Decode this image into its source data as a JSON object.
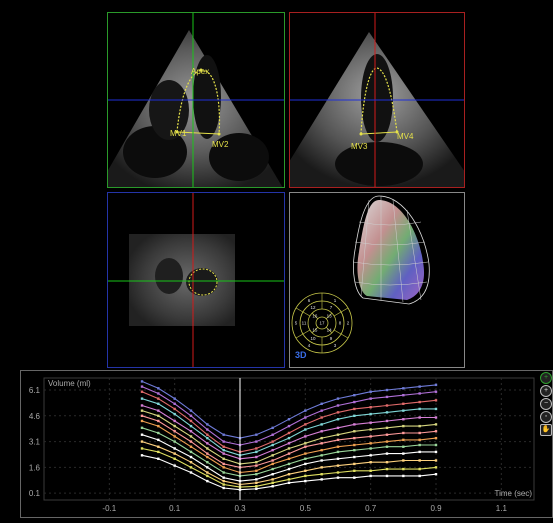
{
  "apical_4ch": {
    "labels": {
      "apex": "Apex",
      "mv1": "MV1",
      "mv2": "MV2"
    }
  },
  "apical_2ch": {
    "labels": {
      "mv3": "MV3",
      "mv4": "MV4"
    }
  },
  "render_3d": {
    "label": "3D",
    "bullseye_segments": [
      "1",
      "2",
      "3",
      "4",
      "5",
      "6",
      "7",
      "8",
      "9",
      "10",
      "11",
      "12",
      "13",
      "14",
      "15",
      "16",
      "17"
    ]
  },
  "toolbar": {
    "icons": [
      "plus-icon",
      "zoom-in-icon",
      "zoom-out-icon",
      "zoom-fit-icon",
      "hand-icon"
    ]
  },
  "colors": {
    "crosshair_green": "#19c419",
    "crosshair_red": "#d21a1a",
    "crosshair_blue": "#1f2fd6",
    "frame_green": "#2a9a2a",
    "frame_red": "#a82020",
    "frame_blue": "#2434a8",
    "frame_gray": "#888888",
    "trace": "#e6e24a",
    "cursor": "#ffffff"
  },
  "chart_data": {
    "type": "line",
    "ylabel": "Volume (ml)",
    "xlabel": "Time (sec)",
    "yticks": [
      "6.1",
      "4.6",
      "3.1",
      "1.6",
      "0.1"
    ],
    "ytick_values": [
      6.1,
      4.6,
      3.1,
      1.6,
      0.1
    ],
    "xticks": [
      "-0.1",
      "0.1",
      "0.3",
      "0.5",
      "0.7",
      "0.9",
      "1.1"
    ],
    "xtick_values": [
      -0.1,
      0.1,
      0.3,
      0.5,
      0.7,
      0.9,
      1.1
    ],
    "xlim": [
      -0.3,
      1.2
    ],
    "ylim": [
      -0.3,
      6.8
    ],
    "cursor_x": 0.3,
    "x": [
      0.0,
      0.05,
      0.1,
      0.15,
      0.2,
      0.25,
      0.3,
      0.35,
      0.4,
      0.45,
      0.5,
      0.55,
      0.6,
      0.65,
      0.7,
      0.75,
      0.8,
      0.85,
      0.9
    ],
    "series": [
      {
        "color": "#6f7bd8",
        "values": [
          6.6,
          6.2,
          5.6,
          4.9,
          4.1,
          3.5,
          3.3,
          3.5,
          3.9,
          4.4,
          4.9,
          5.3,
          5.6,
          5.8,
          6.0,
          6.1,
          6.2,
          6.3,
          6.4
        ]
      },
      {
        "color": "#b070d8",
        "values": [
          6.3,
          5.9,
          5.3,
          4.6,
          3.8,
          3.1,
          2.9,
          3.1,
          3.5,
          4.0,
          4.5,
          4.9,
          5.2,
          5.4,
          5.6,
          5.7,
          5.8,
          5.9,
          6.0
        ]
      },
      {
        "color": "#e06a6a",
        "values": [
          6.0,
          5.6,
          5.0,
          4.3,
          3.5,
          2.8,
          2.5,
          2.7,
          3.1,
          3.6,
          4.1,
          4.5,
          4.8,
          5.0,
          5.1,
          5.2,
          5.3,
          5.4,
          5.5
        ]
      },
      {
        "color": "#7fd6d6",
        "values": [
          5.6,
          5.3,
          4.7,
          4.0,
          3.3,
          2.6,
          2.3,
          2.5,
          2.9,
          3.3,
          3.8,
          4.1,
          4.4,
          4.6,
          4.7,
          4.8,
          4.9,
          5.0,
          5.0
        ]
      },
      {
        "color": "#d67fd6",
        "values": [
          5.2,
          4.9,
          4.3,
          3.7,
          3.0,
          2.4,
          2.1,
          2.2,
          2.6,
          3.0,
          3.4,
          3.7,
          3.9,
          4.1,
          4.2,
          4.3,
          4.4,
          4.5,
          4.5
        ]
      },
      {
        "color": "#d6d67f",
        "values": [
          4.9,
          4.6,
          4.0,
          3.4,
          2.7,
          2.1,
          1.8,
          1.9,
          2.3,
          2.7,
          3.0,
          3.3,
          3.5,
          3.7,
          3.8,
          3.9,
          4.0,
          4.0,
          4.1
        ]
      },
      {
        "color": "#ff9a9a",
        "values": [
          4.6,
          4.3,
          3.7,
          3.1,
          2.4,
          1.8,
          1.6,
          1.7,
          2.0,
          2.4,
          2.8,
          3.0,
          3.2,
          3.3,
          3.4,
          3.5,
          3.6,
          3.6,
          3.7
        ]
      },
      {
        "color": "#f0a050",
        "values": [
          4.3,
          4.0,
          3.4,
          2.8,
          2.2,
          1.6,
          1.3,
          1.4,
          1.8,
          2.1,
          2.4,
          2.6,
          2.8,
          2.9,
          3.0,
          3.1,
          3.2,
          3.2,
          3.3
        ]
      },
      {
        "color": "#9ad69a",
        "values": [
          3.9,
          3.6,
          3.1,
          2.5,
          1.9,
          1.3,
          1.1,
          1.2,
          1.5,
          1.8,
          2.1,
          2.3,
          2.5,
          2.6,
          2.7,
          2.8,
          2.8,
          2.9,
          2.9
        ]
      },
      {
        "color": "#ffffff",
        "values": [
          3.5,
          3.2,
          2.7,
          2.2,
          1.6,
          1.0,
          0.8,
          0.9,
          1.2,
          1.5,
          1.8,
          2.0,
          2.1,
          2.2,
          2.3,
          2.4,
          2.4,
          2.5,
          2.5
        ]
      },
      {
        "color": "#ffd27f",
        "values": [
          3.1,
          2.8,
          2.4,
          1.9,
          1.3,
          0.8,
          0.6,
          0.7,
          0.9,
          1.2,
          1.4,
          1.6,
          1.7,
          1.8,
          1.9,
          1.9,
          2.0,
          2.0,
          2.0
        ]
      },
      {
        "color": "#e0e060",
        "values": [
          2.7,
          2.5,
          2.1,
          1.6,
          1.1,
          0.6,
          0.45,
          0.5,
          0.7,
          0.9,
          1.1,
          1.2,
          1.3,
          1.4,
          1.4,
          1.5,
          1.5,
          1.5,
          1.6
        ]
      },
      {
        "color": "#ffffff",
        "values": [
          2.3,
          2.1,
          1.7,
          1.3,
          0.8,
          0.4,
          0.3,
          0.35,
          0.5,
          0.7,
          0.8,
          0.9,
          1.0,
          1.0,
          1.1,
          1.1,
          1.1,
          1.1,
          1.2
        ]
      }
    ]
  }
}
